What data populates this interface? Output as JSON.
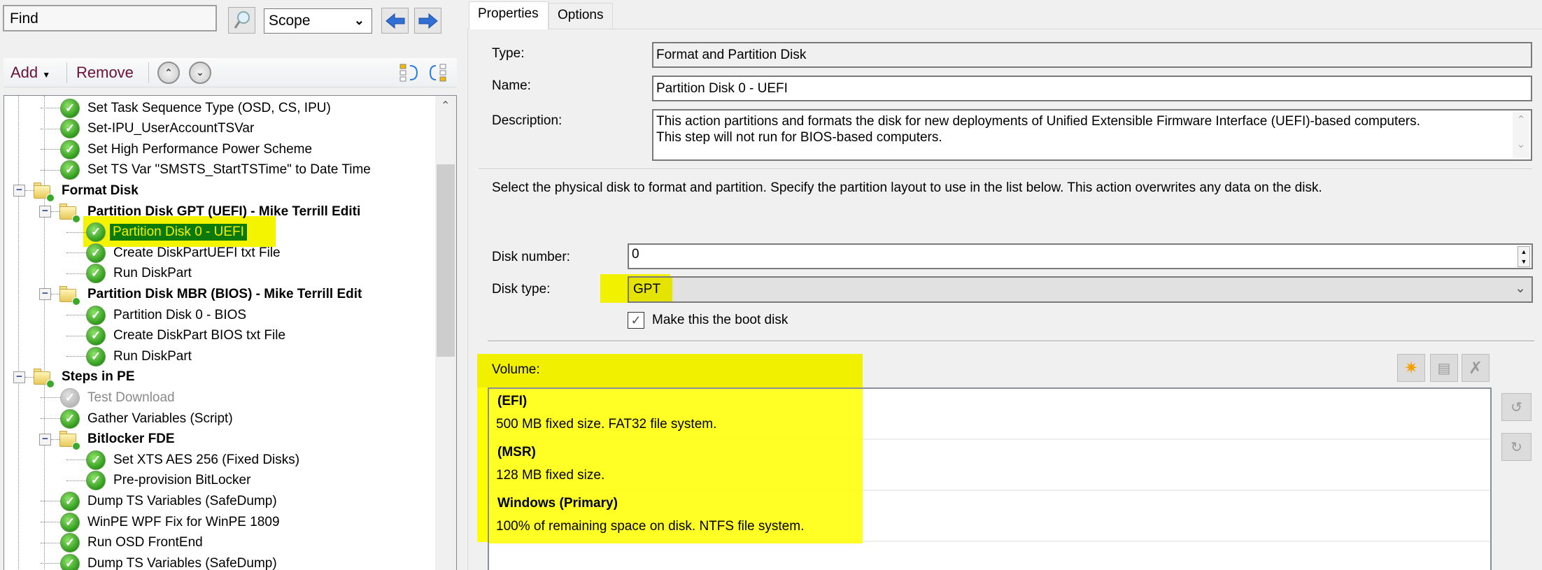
{
  "search": {
    "value": "Find",
    "scope": "Scope"
  },
  "toolbar": {
    "add": "Add",
    "remove": "Remove"
  },
  "tree": {
    "items": [
      {
        "label": "Set Task Sequence Type (OSD, CS, IPU)",
        "level": 1,
        "kind": "step",
        "state": "enabled"
      },
      {
        "label": "Set-IPU_UserAccountTSVar",
        "level": 1,
        "kind": "step",
        "state": "enabled"
      },
      {
        "label": "Set High Performance Power Scheme",
        "level": 1,
        "kind": "step",
        "state": "enabled"
      },
      {
        "label": "Set TS Var \"SMSTS_StartTSTime\" to Date Time",
        "level": 1,
        "kind": "step",
        "state": "enabled"
      },
      {
        "label": "Format Disk",
        "level": 0,
        "kind": "group",
        "state": "expanded"
      },
      {
        "label": "Partition Disk GPT (UEFI) - Mike Terrill Editi",
        "level": 1,
        "kind": "group",
        "state": "expanded"
      },
      {
        "label": "Partition Disk 0 - UEFI",
        "level": 2,
        "kind": "step",
        "state": "selected"
      },
      {
        "label": "Create DiskPartUEFI txt File",
        "level": 2,
        "kind": "step",
        "state": "enabled"
      },
      {
        "label": "Run DiskPart",
        "level": 2,
        "kind": "step",
        "state": "enabled"
      },
      {
        "label": "Partition Disk MBR (BIOS) - Mike Terrill Edit",
        "level": 1,
        "kind": "group",
        "state": "expanded"
      },
      {
        "label": "Partition Disk 0 - BIOS",
        "level": 2,
        "kind": "step",
        "state": "enabled"
      },
      {
        "label": "Create DiskPart BIOS txt File",
        "level": 2,
        "kind": "step",
        "state": "enabled"
      },
      {
        "label": "Run DiskPart",
        "level": 2,
        "kind": "step",
        "state": "enabled"
      },
      {
        "label": "Steps in PE",
        "level": 0,
        "kind": "group",
        "state": "expanded"
      },
      {
        "label": "Test Download",
        "level": 1,
        "kind": "step",
        "state": "disabled"
      },
      {
        "label": "Gather Variables (Script)",
        "level": 1,
        "kind": "step",
        "state": "enabled"
      },
      {
        "label": "Bitlocker FDE",
        "level": 1,
        "kind": "group",
        "state": "expanded"
      },
      {
        "label": "Set XTS AES 256 (Fixed Disks)",
        "level": 2,
        "kind": "step",
        "state": "enabled"
      },
      {
        "label": "Pre-provision BitLocker",
        "level": 2,
        "kind": "step",
        "state": "enabled"
      },
      {
        "label": "Dump TS Variables (SafeDump)",
        "level": 1,
        "kind": "step",
        "state": "enabled"
      },
      {
        "label": "WinPE WPF Fix for WinPE 1809",
        "level": 1,
        "kind": "step",
        "state": "enabled"
      },
      {
        "label": "Run OSD FrontEnd",
        "level": 1,
        "kind": "step",
        "state": "enabled"
      },
      {
        "label": "Dump TS Variables (SafeDump)",
        "level": 1,
        "kind": "step",
        "state": "enabled"
      }
    ]
  },
  "tabs": [
    {
      "label": "Properties",
      "active": true
    },
    {
      "label": "Options",
      "active": false
    }
  ],
  "properties": {
    "type_label": "Type:",
    "type_value": "Format and Partition Disk",
    "name_label": "Name:",
    "name_value": "Partition Disk 0 - UEFI",
    "description_label": "Description:",
    "description_line1": "This action partitions and formats the disk for new deployments of Unified Extensible Firmware Interface (UEFI)-based computers.",
    "description_line2": "This step will not run for BIOS-based computers.",
    "instructions": "Select the physical disk to format and partition. Specify the partition layout to use in the list below. This action overwrites any data on the disk.",
    "disk_number_label": "Disk number:",
    "disk_number_value": "0",
    "disk_type_label": "Disk type:",
    "disk_type_value": "GPT",
    "boot_disk_label": "Make this the boot disk",
    "boot_disk_checked": true,
    "volume_label": "Volume:",
    "volumes": [
      {
        "name": "(EFI)",
        "detail": "500 MB fixed size. FAT32 file system."
      },
      {
        "name": "(MSR)",
        "detail": "128 MB fixed size."
      },
      {
        "name": "Windows (Primary)",
        "detail": "100% of remaining space on disk. NTFS file system."
      }
    ]
  },
  "colors": {
    "highlight": "#f4f400",
    "selection": "#0b7a0b",
    "toolbar_text": "#6b1038"
  }
}
